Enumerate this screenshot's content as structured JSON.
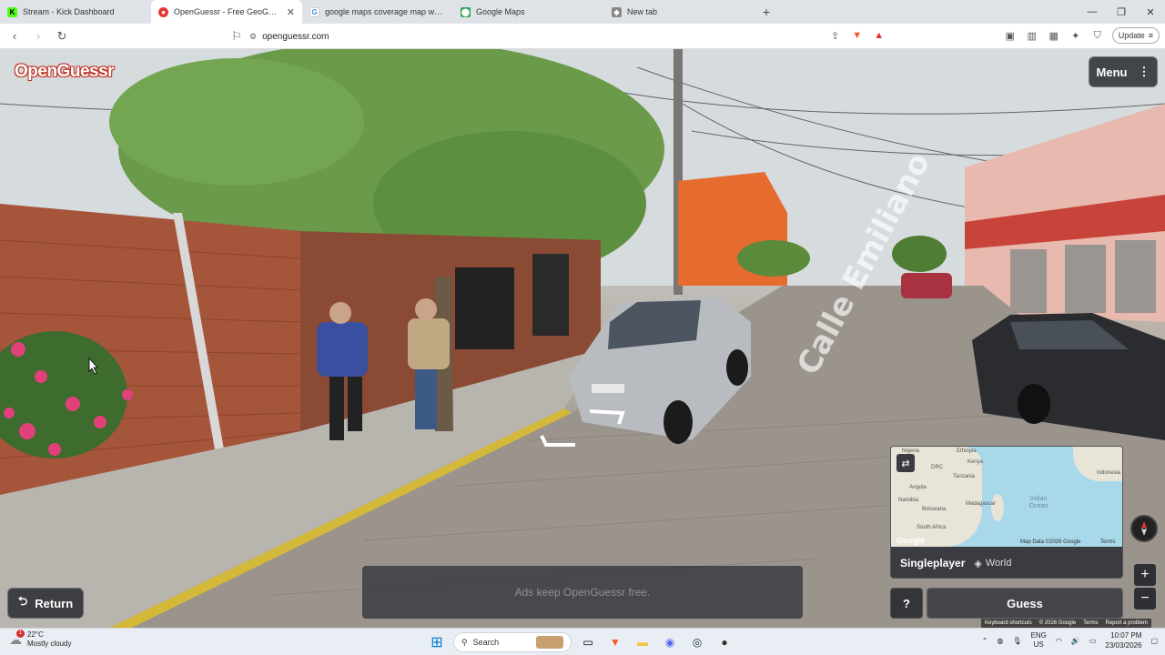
{
  "browser": {
    "tabs": [
      {
        "title": "Stream - Kick Dashboard",
        "icon": "kick-icon",
        "color": "#53fc18"
      },
      {
        "title": "OpenGuessr - Free GeoGuess",
        "icon": "openguessr-icon",
        "color": "#e53935",
        "active": true
      },
      {
        "title": "google maps coverage map world -",
        "icon": "google-search-icon",
        "color": "#aaaaaa"
      },
      {
        "title": "Google Maps",
        "icon": "google-maps-icon",
        "color": "#34a853"
      },
      {
        "title": "New tab",
        "icon": "brave-icon",
        "color": "#888888"
      }
    ],
    "url": "openguessr.com",
    "update_label": "Update"
  },
  "game": {
    "logo": "OpenGuessr",
    "menu_label": "Menu",
    "return_label": "Return",
    "ad_text": "Ads keep OpenGuessr free.",
    "street_sign": "Calle Emiliano",
    "minimap": {
      "labels": [
        "Nigeria",
        "Ethiopia",
        "Kenya",
        "DRC",
        "Tanzania",
        "Angola",
        "Namibia",
        "Botswana",
        "Madagascar",
        "South Africa",
        "Indonesia"
      ],
      "ocean": "Indian Ocean",
      "map_data": "Map Data ©2026 Google",
      "terms": "Terms",
      "google": "Google"
    },
    "mode": "Singleplayer",
    "region": "World",
    "help_label": "?",
    "guess_label": "Guess",
    "footer": [
      "Keyboard shortcuts",
      "© 2026 Google",
      "Terms",
      "Report a problem"
    ]
  },
  "taskbar": {
    "temperature": "22°C",
    "condition": "Mostly cloudy",
    "search_label": "Search",
    "lang_top": "ENG",
    "lang_bottom": "US",
    "time": "10:07 PM",
    "date": "23/03/2026",
    "notification_count": "1"
  }
}
